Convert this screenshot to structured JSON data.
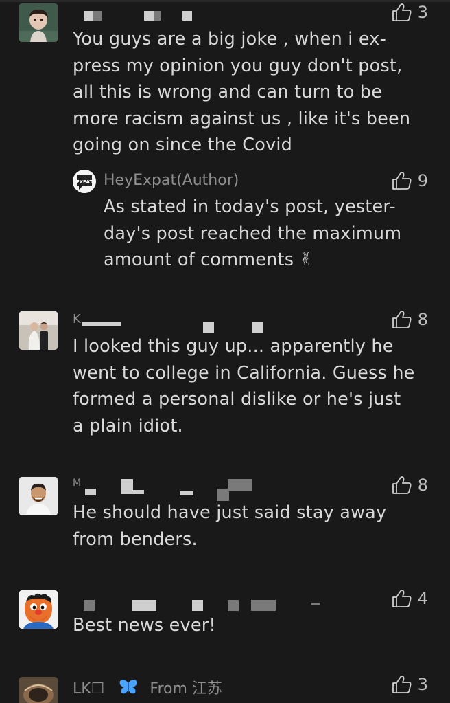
{
  "comments": [
    {
      "likes": "3",
      "text_lines": [
        "You guys are a big joke , when i ex-",
        "press my opinion you guy don't post,",
        "all this is wrong and can turn to be",
        "more racism against us , like it's been",
        "going on since the Covid"
      ],
      "reply": {
        "author": "HeyExpat(Author)",
        "logo_text": "EXPAT",
        "likes": "9",
        "text_lines": [
          "As stated in today's post, yester-",
          "day's post reached the maximum",
          "amount of comments ✌"
        ]
      }
    },
    {
      "name_initial": "K",
      "likes": "8",
      "text_lines": [
        "I looked this guy up... apparently he",
        "went to college in California. Guess he",
        "formed a personal dislike or he's just",
        "a plain idiot."
      ]
    },
    {
      "name_initial": "M",
      "likes": "8",
      "text_lines": [
        "He should have just said stay away",
        "from benders."
      ]
    },
    {
      "likes": "4",
      "text_lines": [
        "Best news ever!"
      ]
    },
    {
      "name": "LK☐",
      "from_label": "From 江苏",
      "likes": "3"
    }
  ],
  "icons": {
    "like": "thumbs-up-outline-icon",
    "badge": "butterfly-icon"
  },
  "colors": {
    "background": "#191919",
    "text": "#d9d9d9",
    "meta": "#8e8e8e",
    "butterfly": "#4aa3ff"
  }
}
